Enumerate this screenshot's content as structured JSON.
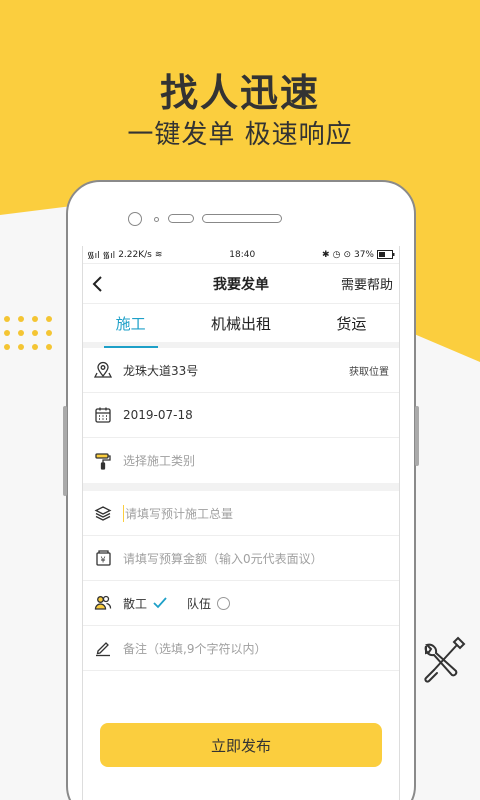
{
  "hero": {
    "title": "找人迅速",
    "subtitle": "一键发单  极速响应"
  },
  "colors": {
    "accent_yellow": "#fbce3e",
    "tab_active": "#1ea0c8"
  },
  "status_bar": {
    "signal": "᯾ıl ᯾ıl",
    "speed": "2.22K/s",
    "time": "18:40",
    "battery": "37%"
  },
  "nav": {
    "title": "我要发单",
    "help": "需要帮助"
  },
  "tabs": [
    {
      "label": "施工",
      "active": true
    },
    {
      "label": "机械出租",
      "active": false
    },
    {
      "label": "货运",
      "active": false
    }
  ],
  "form": {
    "location": {
      "value": "龙珠大道33号",
      "action": "获取位置",
      "icon": "location-pin-icon"
    },
    "date": {
      "value": "2019-07-18",
      "icon": "calendar-icon"
    },
    "category": {
      "placeholder": "选择施工类别",
      "icon": "paint-roller-icon"
    },
    "quantity": {
      "placeholder": "请填写预计施工总量",
      "icon": "layers-icon"
    },
    "budget": {
      "placeholder": "请填写预算金额（输入0元代表面议）",
      "icon": "money-icon"
    },
    "worker_type": {
      "options": [
        "散工",
        "队伍"
      ],
      "selected": "散工",
      "icon": "users-icon"
    },
    "note": {
      "placeholder": "备注（选填,9个字符以内）",
      "icon": "pencil-icon"
    }
  },
  "submit_label": "立即发布"
}
